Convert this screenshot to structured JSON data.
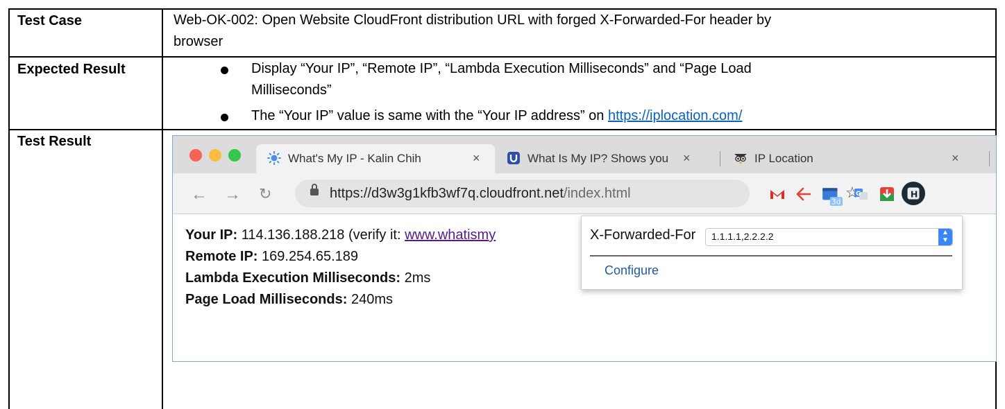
{
  "table": {
    "rows": [
      {
        "label": "Test Case",
        "lines": [
          "Web-OK-002: Open Website CloudFront distribution URL with forged X-Forwarded-For header by",
          "browser"
        ]
      },
      {
        "label": "Expected Result",
        "bullets": [
          {
            "lines": [
              "Display “Your IP”, “Remote IP”, “Lambda Execution Milliseconds” and “Page Load",
              "Milliseconds”"
            ]
          },
          {
            "text": "The “Your IP” value is same with the “Your IP address” on ",
            "link": "https://iplocation.com/"
          }
        ]
      },
      {
        "label": "Test Result"
      }
    ]
  },
  "browser": {
    "tabs": [
      {
        "title": "What's My IP - Kalin Chih",
        "icon": "sun-icon",
        "close": "×"
      },
      {
        "title": "What Is My IP? Shows you",
        "icon": "u-logo-icon",
        "close": "×"
      },
      {
        "title": "IP Location",
        "icon": "owl-icon",
        "close": "×"
      }
    ],
    "address": {
      "scheme_host": "https://d3w3g1kfb3wf7q.cloudfront.net",
      "path": "/index.html"
    },
    "extensions": [
      "gmail-icon",
      "back-arrow-icon",
      "3d-icon",
      "translate-icon",
      "download-icon",
      "h-icon"
    ],
    "ext_badge": "3d",
    "ext_h": "H",
    "page": {
      "your_ip_label": "Your IP:",
      "your_ip_value": " 114.136.188.218 (verify it: ",
      "your_ip_link": "www.whatismy",
      "remote_ip_label": "Remote IP:",
      "remote_ip_value": " 169.254.65.189",
      "lambda_label": "Lambda Execution Milliseconds:",
      "lambda_value": " 2ms",
      "page_load_label": "Page Load Milliseconds:",
      "page_load_value": " 240ms"
    },
    "popup": {
      "label": "X-Forwarded-For",
      "value": "1.1.1.1,2.2.2.2",
      "configure": "Configure"
    }
  },
  "colors": {
    "link": "#0563c1",
    "visited": "#551a8b",
    "traffic_red": "#fc605b",
    "traffic_yellow": "#fdbc40",
    "traffic_green": "#34c84a"
  }
}
